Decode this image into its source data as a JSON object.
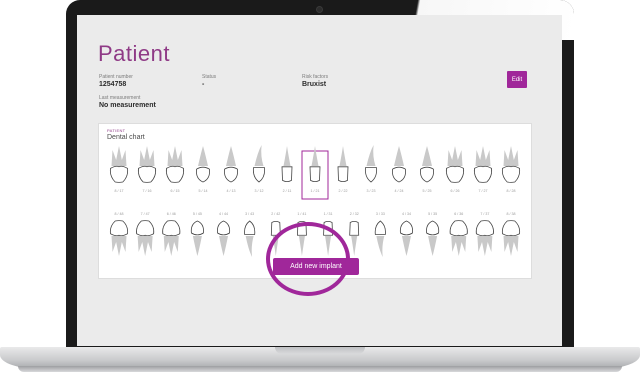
{
  "page": {
    "title": "Patient"
  },
  "fields": {
    "patient_number": {
      "label": "Patient number",
      "value": "1254758"
    },
    "status": {
      "label": "Status",
      "value": "-"
    },
    "risk_factors": {
      "label": "Risk factors",
      "value": "Bruxist"
    },
    "last_measurement": {
      "label": "Last measurement",
      "value": "No measurement"
    }
  },
  "actions": {
    "edit_label": "Edit",
    "add_implant_label": "Add new implant"
  },
  "dental_chart": {
    "kicker": "PATIENT",
    "title": "Dental chart",
    "upper_teeth": [
      {
        "label": "8 / 17",
        "kind": "molar"
      },
      {
        "label": "7 / 16",
        "kind": "molar"
      },
      {
        "label": "6 / 15",
        "kind": "molar"
      },
      {
        "label": "5 / 14",
        "kind": "premolar"
      },
      {
        "label": "4 / 13",
        "kind": "premolar"
      },
      {
        "label": "3 / 12",
        "kind": "canine"
      },
      {
        "label": "2 / 11",
        "kind": "incisor"
      },
      {
        "label": "1 / 21",
        "kind": "incisor"
      },
      {
        "label": "2 / 22",
        "kind": "incisor"
      },
      {
        "label": "3 / 23",
        "kind": "canine"
      },
      {
        "label": "4 / 24",
        "kind": "premolar"
      },
      {
        "label": "5 / 25",
        "kind": "premolar"
      },
      {
        "label": "6 / 26",
        "kind": "molar"
      },
      {
        "label": "7 / 27",
        "kind": "molar"
      },
      {
        "label": "8 / 28",
        "kind": "molar"
      }
    ],
    "selected_upper_index": 7,
    "lower_teeth": [
      {
        "label": "8 / 48",
        "kind": "molar"
      },
      {
        "label": "7 / 47",
        "kind": "molar"
      },
      {
        "label": "6 / 46",
        "kind": "molar"
      },
      {
        "label": "5 / 45",
        "kind": "premolar"
      },
      {
        "label": "4 / 44",
        "kind": "premolar"
      },
      {
        "label": "3 / 43",
        "kind": "canine"
      },
      {
        "label": "2 / 42",
        "kind": "incisor"
      },
      {
        "label": "1 / 41",
        "kind": "incisor"
      },
      {
        "label": "1 / 31",
        "kind": "incisor"
      },
      {
        "label": "2 / 32",
        "kind": "incisor"
      },
      {
        "label": "3 / 33",
        "kind": "canine"
      },
      {
        "label": "4 / 34",
        "kind": "premolar"
      },
      {
        "label": "5 / 35",
        "kind": "premolar"
      },
      {
        "label": "6 / 36",
        "kind": "molar"
      },
      {
        "label": "7 / 37",
        "kind": "molar"
      },
      {
        "label": "8 / 38",
        "kind": "molar"
      }
    ]
  },
  "colors": {
    "accent": "#a0279a",
    "title": "#8f3a86",
    "screen_bg": "#ebebeb",
    "tooth_root": "#c9c9c9"
  }
}
